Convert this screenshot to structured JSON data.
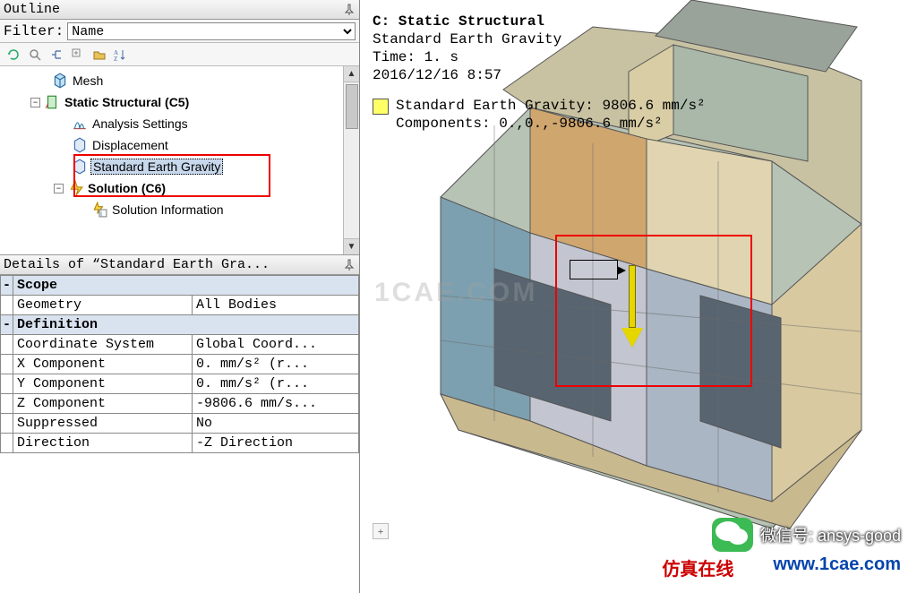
{
  "outline": {
    "title": "Outline",
    "filter_label": "Filter:",
    "filter_value": "Name",
    "tree": {
      "mesh": "Mesh",
      "static": "Static Structural (C5)",
      "analysis": "Analysis Settings",
      "displacement": "Displacement",
      "gravity": "Standard Earth Gravity",
      "solution": "Solution (C6)",
      "solinfo": "Solution Information"
    }
  },
  "details": {
    "title": "Details of “Standard Earth Gra...",
    "sections": {
      "scope": "Scope",
      "definition": "Definition"
    },
    "rows": {
      "geometry_k": "Geometry",
      "geometry_v": "All Bodies",
      "coord_k": "Coordinate System",
      "coord_v": "Global Coord...",
      "x_k": "X Component",
      "x_v": "0. mm/s²  (r...",
      "y_k": "Y Component",
      "y_v": "0. mm/s²  (r...",
      "z_k": "Z Component",
      "z_v": "-9806.6 mm/s...",
      "sup_k": "Suppressed",
      "sup_v": "No",
      "dir_k": "Direction",
      "dir_v": "-Z Direction"
    }
  },
  "viewport": {
    "title": "C: Static Structural",
    "subtitle": "Standard Earth Gravity",
    "time": "Time: 1. s",
    "timestamp": "2016/12/16 8:57",
    "legend_line1": "Standard Earth Gravity: 9806.6 mm/s²",
    "legend_line2": "Components: 0.,0.,-9806.6 mm/s²"
  },
  "branding": {
    "watermark": "1CAE.COM",
    "wechat_label": "微信号: ansys-good",
    "link_cn": "仿真在线",
    "link_en": "www.1cae.com"
  }
}
